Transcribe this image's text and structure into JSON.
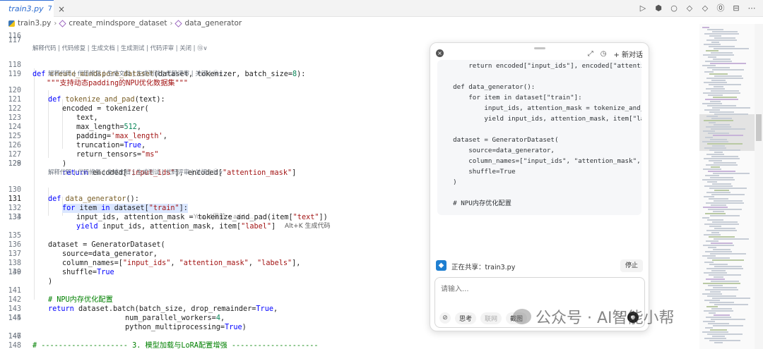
{
  "tab": {
    "name": "train3.py",
    "modified": "7",
    "close": "×"
  },
  "toolbar_icons": [
    "▷",
    "⬢",
    "○",
    "◇",
    "◇",
    "⓪",
    "⊟",
    "⋯"
  ],
  "breadcrumb": {
    "file": "train3.py",
    "func1": "create_mindspore_dataset",
    "func2": "data_generator"
  },
  "codelens": {
    "full": "解释代码 | 代码修复 | 生成文档 | 生成测试 | 代码评审 | 关闭 | ⑬∨"
  },
  "ghost_text": "You, 4周前 • add ...",
  "ghost_hint": "Alt+K 生成代码",
  "lines": [
    {
      "n": "116"
    },
    {
      "n": "117"
    },
    {
      "n": "118"
    },
    {
      "n": "119"
    },
    {
      "n": "120"
    },
    {
      "n": "121"
    },
    {
      "n": "122"
    },
    {
      "n": "123"
    },
    {
      "n": "124"
    },
    {
      "n": "125"
    },
    {
      "n": "126"
    },
    {
      "n": "127"
    },
    {
      "n": "128"
    },
    {
      "n": "129"
    },
    {
      "n": "130"
    },
    {
      "n": "131"
    },
    {
      "n": "132"
    },
    {
      "n": "133"
    },
    {
      "n": "134"
    },
    {
      "n": "135"
    },
    {
      "n": "136"
    },
    {
      "n": "137"
    },
    {
      "n": "138"
    },
    {
      "n": "139"
    },
    {
      "n": "140"
    },
    {
      "n": "141"
    },
    {
      "n": "142"
    },
    {
      "n": "143"
    },
    {
      "n": "144"
    },
    {
      "n": "145"
    },
    {
      "n": "146"
    },
    {
      "n": "147"
    },
    {
      "n": "148"
    }
  ],
  "code": {
    "l118": {
      "kw": "def",
      "name": "create_mindspore_dataset",
      "args": "(dataset, tokenizer, batch_size=",
      "num": "8",
      "end": "):"
    },
    "l119": "\"\"\"支持动态padding的NPU优化数据集\"\"\"",
    "l120": {
      "kw": "def",
      "name": "tokenize_and_pad",
      "args": "(text):"
    },
    "l121": "encoded = tokenizer(",
    "l122": "text,",
    "l123": {
      "a": "max_length=",
      "num": "512",
      "b": ","
    },
    "l124": {
      "a": "padding=",
      "str": "'max_length'",
      "b": ","
    },
    "l125": {
      "a": "truncation=",
      "kw": "True",
      "b": ","
    },
    "l126": {
      "a": "return_tensors=",
      "str": "\"ms\""
    },
    "l127": ")",
    "l128": {
      "kw": "return",
      "a": " encoded[",
      "s1": "\"input_ids\"",
      "b": "], encoded[",
      "s2": "\"attention_mask\"",
      "c": "]"
    },
    "l130": {
      "kw": "def",
      "name": "data_generator",
      "args": "():"
    },
    "l131": {
      "kw1": "for",
      "a": " item ",
      "kw2": "in",
      "b": " dataset[",
      "s": "\"train\"",
      "c": "]:"
    },
    "l132": {
      "a": "input_ids, attention_mask = tokenize_and_pad(item[",
      "s": "\"text\"",
      "b": "])"
    },
    "l133": {
      "kw": "yield",
      "a": " input_ids, attention_mask, item[",
      "s": "\"label\"",
      "b": "]"
    },
    "l135": "dataset = GeneratorDataset(",
    "l136": "source=data_generator,",
    "l137": {
      "a": "column_names=[",
      "s1": "\"input_ids\"",
      "b": ", ",
      "s2": "\"attention_mask\"",
      "c": ", ",
      "s3": "\"labels\"",
      "d": "],"
    },
    "l138": {
      "a": "shuffle=",
      "kw": "True"
    },
    "l139": ")",
    "l141": "# NPU内存优化配置",
    "l142": {
      "kw": "return",
      "a": " dataset.batch(batch_size, drop_remainder=",
      "kw2": "True",
      "b": ","
    },
    "l143": {
      "a": "num_parallel_workers=",
      "num": "4",
      "b": ","
    },
    "l144": {
      "a": "python_multiprocessing=",
      "kw": "True",
      "b": ")"
    },
    "l146": "# -------------------- 3. 模型加载与LoRA配置增强 --------------------"
  },
  "panel": {
    "close": "×",
    "icons": [
      "⤢",
      "◷"
    ],
    "new_chat": "+ 新对话",
    "code": [
      {
        "t": "        return encoded[\"input_ids\"], encoded[\"attention_mask\"]"
      },
      {
        "t": ""
      },
      {
        "t": "    def data_generator():"
      },
      {
        "t": "        for item in dataset[\"train\"]:"
      },
      {
        "t": "            input_ids, attention_mask = tokenize_and_pad(item[\"text\"])"
      },
      {
        "t": "            yield input_ids, attention_mask, item[\"label\"]"
      },
      {
        "t": ""
      },
      {
        "t": "    dataset = GeneratorDataset("
      },
      {
        "t": "        source=data_generator,"
      },
      {
        "t": "        column_names=[\"input_ids\", \"attention_mask\", \"labels\"],"
      },
      {
        "t": "        shuffle=True"
      },
      {
        "t": "    )"
      },
      {
        "t": ""
      },
      {
        "t": "    # NPU内存优化配置"
      }
    ],
    "sharing_label": "正在共享：train3.py",
    "stop_label": "停止",
    "input_placeholder": "请输入...",
    "tools": {
      "attach": "⊘",
      "think": "思考",
      "search": "联网",
      "screen": "截图"
    },
    "mic": "♪",
    "send": "●"
  },
  "watermark": "公众号 · AI智能小帮"
}
